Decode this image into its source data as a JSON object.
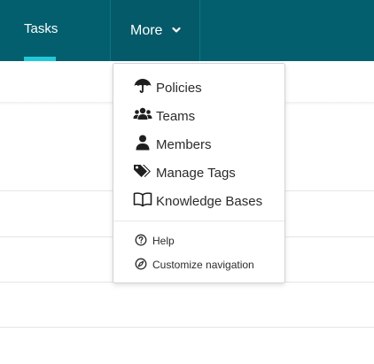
{
  "nav": {
    "tasks_label": "Tasks",
    "more_label": "More"
  },
  "dropdown": {
    "items": [
      {
        "label": "Policies",
        "icon": "umbrella-icon"
      },
      {
        "label": "Teams",
        "icon": "users-icon"
      },
      {
        "label": "Members",
        "icon": "user-icon"
      },
      {
        "label": "Manage Tags",
        "icon": "tags-icon"
      },
      {
        "label": "Knowledge Bases",
        "icon": "book-icon"
      }
    ],
    "secondary": [
      {
        "label": "Help",
        "icon": "question-circle-icon"
      },
      {
        "label": "Customize navigation",
        "icon": "compass-icon"
      }
    ]
  },
  "colors": {
    "header_bg": "#035f6e",
    "active_underline": "#20c9d9"
  }
}
